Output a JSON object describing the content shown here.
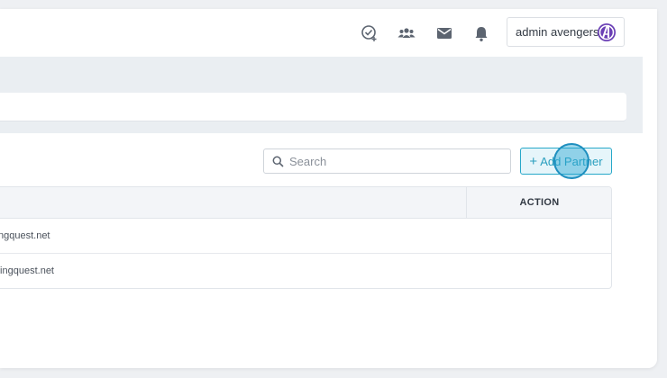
{
  "header": {
    "icons": [
      "task-check-icon",
      "team-icon",
      "mail-icon",
      "bell-icon"
    ],
    "user_name": "admin avengers"
  },
  "toolbar": {
    "search_placeholder": "Search",
    "add_button_label": "Add Partner",
    "add_button_prefix": "+"
  },
  "table": {
    "columns": [
      "",
      "ACTION"
    ],
    "rows": [
      {
        "cell": "ngquest.net"
      },
      {
        "cell": "tingquest.net"
      }
    ]
  },
  "colors": {
    "accent": "#27a8c9",
    "page_bg": "#eaeef2",
    "avatar_purple": "#6a3fb5"
  }
}
